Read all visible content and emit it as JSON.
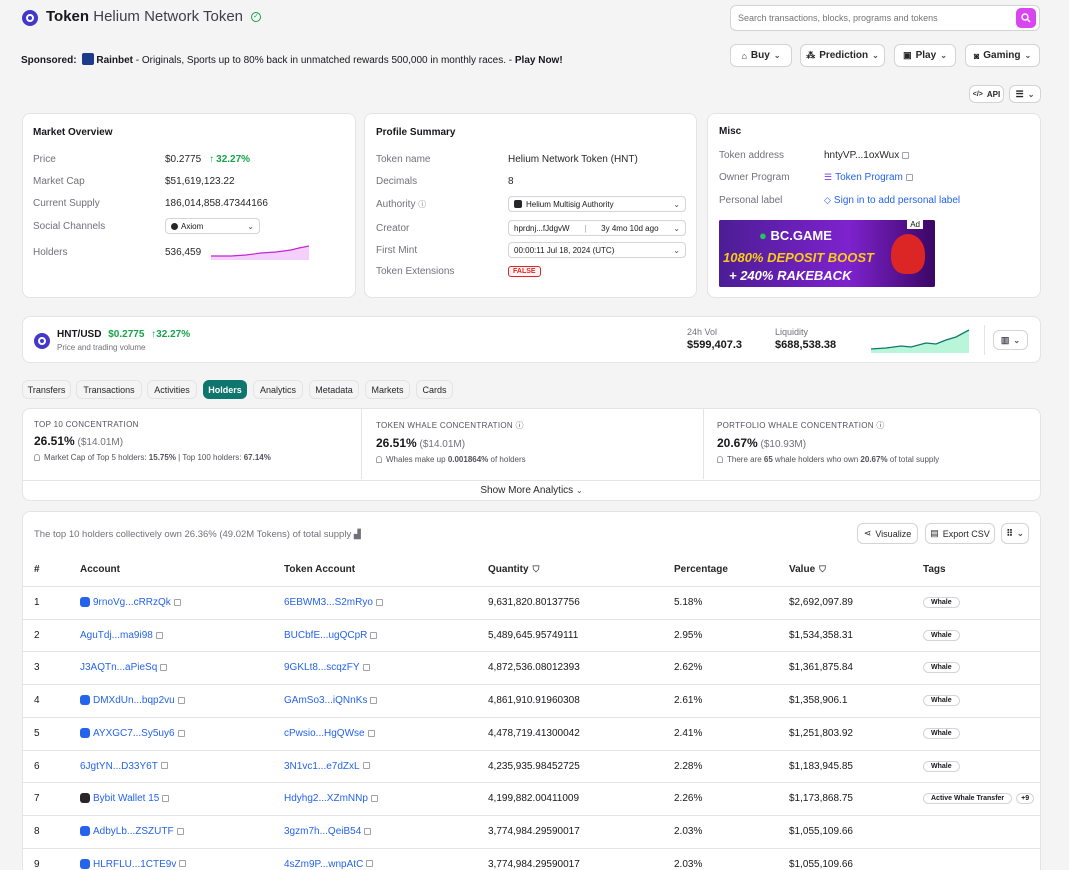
{
  "header": {
    "title_prefix": "Token",
    "title_name": "Helium Network Token",
    "search_placeholder": "Search transactions, blocks, programs and tokens"
  },
  "sponsor": {
    "label": "Sponsored:",
    "brand": "Rainbet",
    "text": " - Originals, Sports up to 80% back in unmatched rewards 500,000 in monthly races. - ",
    "cta": "Play Now!"
  },
  "nav": {
    "buy": "Buy",
    "prediction": "Prediction",
    "play": "Play",
    "gaming": "Gaming",
    "api": "API"
  },
  "market": {
    "title": "Market Overview",
    "price_label": "Price",
    "price": "$0.2775",
    "price_change": "32.27%",
    "mcap_label": "Market Cap",
    "mcap": "$51,619,123.22",
    "supply_label": "Current Supply",
    "supply": "186,014,858.47344166",
    "social_label": "Social Channels",
    "social_value": "Axiom",
    "holders_label": "Holders",
    "holders": "536,459"
  },
  "profile": {
    "title": "Profile Summary",
    "name_label": "Token name",
    "name": "Helium Network Token (HNT)",
    "decimals_label": "Decimals",
    "decimals": "8",
    "authority_label": "Authority",
    "authority": "Helium Multisig Authority",
    "creator_label": "Creator",
    "creator": "hprdnj...fJdgvW",
    "creator_age": "3y 4mo 10d ago",
    "mint_label": "First Mint",
    "mint": "00:00:11 Jul 18, 2024 (UTC)",
    "ext_label": "Token Extensions",
    "ext": "FALSE"
  },
  "misc": {
    "title": "Misc",
    "address_label": "Token address",
    "address": "hntyVP...1oxWux",
    "owner_label": "Owner Program",
    "owner": "Token Program",
    "personal_label": "Personal label",
    "personal": "Sign in to add personal label",
    "ad_tag": "Ad",
    "ad_brand": "BC.GAME",
    "ad_line1": "1080% DEPOSIT BOOST",
    "ad_line2": "+ 240% RAKEBACK"
  },
  "pricebar": {
    "pair": "HNT/USD",
    "price": "$0.2775",
    "change": "32.27%",
    "sub": "Price and trading volume",
    "vol_label": "24h Vol",
    "vol": "$599,407.3",
    "liq_label": "Liquidity",
    "liq": "$688,538.38"
  },
  "tabs": [
    "Transfers",
    "Transactions",
    "Activities",
    "Holders",
    "Analytics",
    "Metadata",
    "Markets",
    "Cards"
  ],
  "analytics": {
    "c1_label": "TOP 10 CONCENTRATION",
    "c1_value": "26.51%",
    "c1_sub": "($14.01M)",
    "c1_note_a": "Market Cap of Top 5 holders: ",
    "c1_note_b": "15.75%",
    "c1_note_c": " | Top 100 holders: ",
    "c1_note_d": "67.14%",
    "c2_label": "TOKEN WHALE CONCENTRATION",
    "c2_value": "26.51%",
    "c2_sub": "($14.01M)",
    "c2_note_a": "Whales make up ",
    "c2_note_b": "0.001864%",
    "c2_note_c": " of holders",
    "c3_label": "PORTFOLIO WHALE CONCENTRATION",
    "c3_value": "20.67%",
    "c3_sub": "($10.93M)",
    "c3_note_a": "There are ",
    "c3_note_b": "65",
    "c3_note_c": " whale holders who own ",
    "c3_note_d": "20.67%",
    "c3_note_e": " of total supply",
    "more": "Show More Analytics"
  },
  "holders": {
    "summary": "The top 10 holders collectively own 26.36% (49.02M Tokens) of total supply",
    "visualize": "Visualize",
    "export": "Export CSV",
    "columns": [
      "#",
      "Account",
      "Token Account",
      "Quantity",
      "Percentage",
      "Value",
      "Tags"
    ],
    "rows": [
      {
        "rank": "1",
        "account": "9rnoVg...cRRzQk",
        "token_account": "6EBWM3...S2mRyo",
        "quantity": "9,631,820.80137756",
        "pct": "5.18%",
        "value": "$2,692,097.89",
        "tag": "Whale",
        "extra": "",
        "logo": "blue"
      },
      {
        "rank": "2",
        "account": "AguTdj...ma9i98",
        "token_account": "BUCbfE...ugQCpR",
        "quantity": "5,489,645.95749111",
        "pct": "2.95%",
        "value": "$1,534,358.31",
        "tag": "Whale",
        "extra": "",
        "logo": ""
      },
      {
        "rank": "3",
        "account": "J3AQTn...aPieSq",
        "token_account": "9GKLt8...scqzFY",
        "quantity": "4,872,536.08012393",
        "pct": "2.62%",
        "value": "$1,361,875.84",
        "tag": "Whale",
        "extra": "",
        "logo": ""
      },
      {
        "rank": "4",
        "account": "DMXdUn...bqp2vu",
        "token_account": "GAmSo3...iQNnKs",
        "quantity": "4,861,910.91960308",
        "pct": "2.61%",
        "value": "$1,358,906.1",
        "tag": "Whale",
        "extra": "",
        "logo": "blue"
      },
      {
        "rank": "5",
        "account": "AYXGC7...Sy5uy6",
        "token_account": "cPwsio...HgQWse",
        "quantity": "4,478,719.41300042",
        "pct": "2.41%",
        "value": "$1,251,803.92",
        "tag": "Whale",
        "extra": "",
        "logo": "blue"
      },
      {
        "rank": "6",
        "account": "6JgtYN...D33Y6T",
        "token_account": "3N1vc1...e7dZxL",
        "quantity": "4,235,935.98452725",
        "pct": "2.28%",
        "value": "$1,183,945.85",
        "tag": "Whale",
        "extra": "",
        "logo": ""
      },
      {
        "rank": "7",
        "account": "Bybit Wallet 15",
        "token_account": "Hdyhg2...XZmNNp",
        "quantity": "4,199,882.00411009",
        "pct": "2.26%",
        "value": "$1,173,868.75",
        "tag": "Active Whale Transfer",
        "extra": "+9",
        "logo": "dark"
      },
      {
        "rank": "8",
        "account": "AdbyLb...ZSZUTF",
        "token_account": "3gzm7h...QeiB54",
        "quantity": "3,774,984.29590017",
        "pct": "2.03%",
        "value": "$1,055,109.66",
        "tag": "",
        "extra": "",
        "logo": "blue"
      },
      {
        "rank": "9",
        "account": "HLRFLU...1CTE9v",
        "token_account": "4sZm9P...wnpAtC",
        "quantity": "3,774,984.29590017",
        "pct": "2.03%",
        "value": "$1,055,109.66",
        "tag": "",
        "extra": "",
        "logo": "blue"
      }
    ]
  },
  "colors": {
    "accent": "#0f766e",
    "search_button": "#d946ef",
    "positive": "#16a34a",
    "link": "#2563eb",
    "danger": "#dc2626"
  }
}
